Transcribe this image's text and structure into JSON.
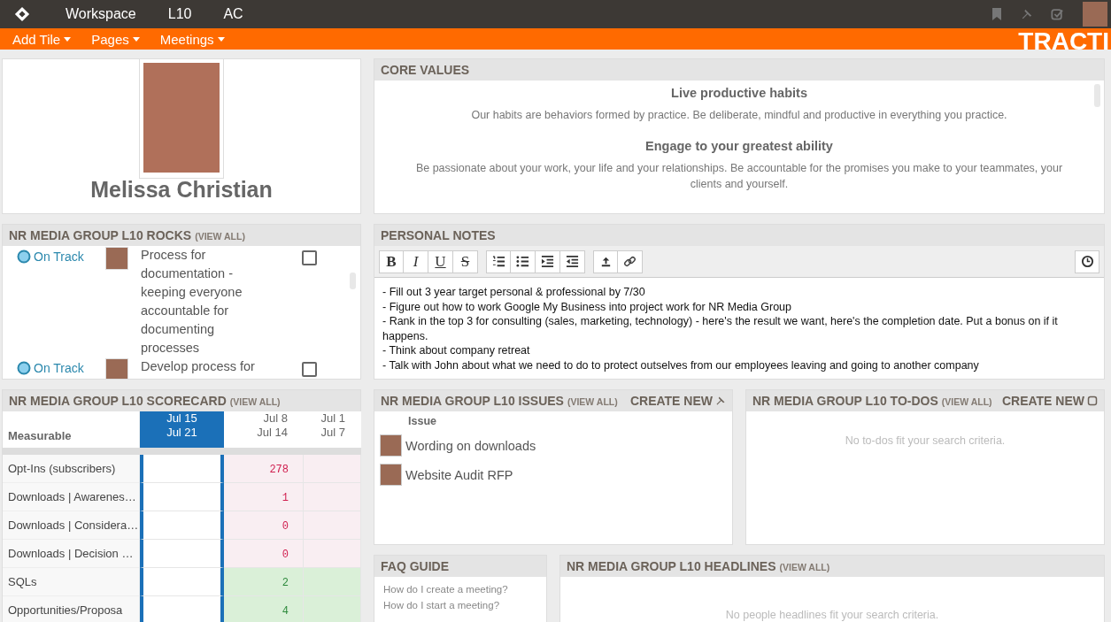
{
  "top_nav": {
    "items": [
      "Workspace",
      "L10",
      "AC"
    ]
  },
  "sub_nav": {
    "menus": [
      "Add Tile",
      "Pages",
      "Meetings"
    ],
    "brand": "TRACTI"
  },
  "profile": {
    "name": "Melissa Christian"
  },
  "core_values": {
    "title": "CORE VALUES",
    "items": [
      {
        "title": "Live productive habits",
        "text": "Our habits are behaviors formed by practice. Be deliberate, mindful and productive in everything you practice."
      },
      {
        "title": "Engage to your greatest ability",
        "text": "Be passionate about your work, your life and your relationships.  Be accountable for the promises you make to your teammates, your clients and yourself."
      }
    ]
  },
  "rocks": {
    "title": "NR MEDIA GROUP L10 ROCKS",
    "view_all": "(VIEW ALL)",
    "items": [
      {
        "status": "On Track",
        "text": "Process for documentation - keeping everyone accountable for documenting processes",
        "checked": false
      },
      {
        "status": "On Track",
        "text": "Develop process for",
        "checked": false
      }
    ]
  },
  "notes": {
    "title": "PERSONAL NOTES",
    "format_buttons": [
      "B",
      "I",
      "U",
      "S"
    ],
    "lines": [
      "- Fill out 3 year target personal & professional by 7/30",
      "- Figure out how to work Google My Business into project work for NR Media Group",
      "- Rank in the top 3 for consulting (sales, marketing, technology) - here's the result we want, here's the completion date.  Put a bonus on if it happens.",
      "- Think about company retreat",
      "- Talk with John about what we need to do to protect outselves from our employees leaving and going to another company"
    ]
  },
  "scorecard": {
    "title": "NR MEDIA GROUP L10 SCORECARD",
    "view_all": "(VIEW ALL)",
    "measurable_label": "Measurable",
    "weeks": [
      {
        "start": "Jul 15",
        "end": "Jul 21",
        "selected": true
      },
      {
        "start": "Jul 8",
        "end": "Jul 14",
        "selected": false
      },
      {
        "start": "Jul 1",
        "end": "Jul 7",
        "selected": false
      }
    ],
    "rows": [
      {
        "name": "Opt-Ins (subscribers)",
        "cells": [
          {},
          {
            "value": "278",
            "met": false
          },
          {
            "met": false
          }
        ]
      },
      {
        "name": "Downloads | Awarenes…",
        "cells": [
          {},
          {
            "value": "1",
            "met": false
          },
          {
            "met": false
          }
        ]
      },
      {
        "name": "Downloads | Considera…",
        "cells": [
          {},
          {
            "value": "0",
            "met": false
          },
          {
            "met": false
          }
        ]
      },
      {
        "name": "Downloads | Decision …",
        "cells": [
          {},
          {
            "value": "0",
            "met": false
          },
          {
            "met": false
          }
        ]
      },
      {
        "name": "SQLs",
        "cells": [
          {},
          {
            "value": "2",
            "met": true
          },
          {
            "met": true
          }
        ]
      },
      {
        "name": "Opportunities/Proposa",
        "cells": [
          {},
          {
            "value": "4",
            "met": true
          },
          {
            "met": true
          }
        ]
      }
    ]
  },
  "issues": {
    "title": "NR MEDIA GROUP L10 ISSUES",
    "view_all": "(VIEW ALL)",
    "create_new": "CREATE NEW",
    "column": "Issue",
    "items": [
      "Wording on downloads",
      "Website Audit RFP"
    ]
  },
  "todos": {
    "title": "NR MEDIA GROUP L10 TO-DOS",
    "view_all": "(VIEW ALL)",
    "create_new": "CREATE NEW",
    "empty": "No to-dos fit your search criteria."
  },
  "faq": {
    "title": "FAQ GUIDE",
    "items": [
      "How do I create a meeting?",
      "How do I start a meeting?"
    ]
  },
  "headlines": {
    "title": "NR MEDIA GROUP L10 HEADLINES",
    "view_all": "(VIEW ALL)",
    "empty": "No people headlines fit your search criteria."
  }
}
